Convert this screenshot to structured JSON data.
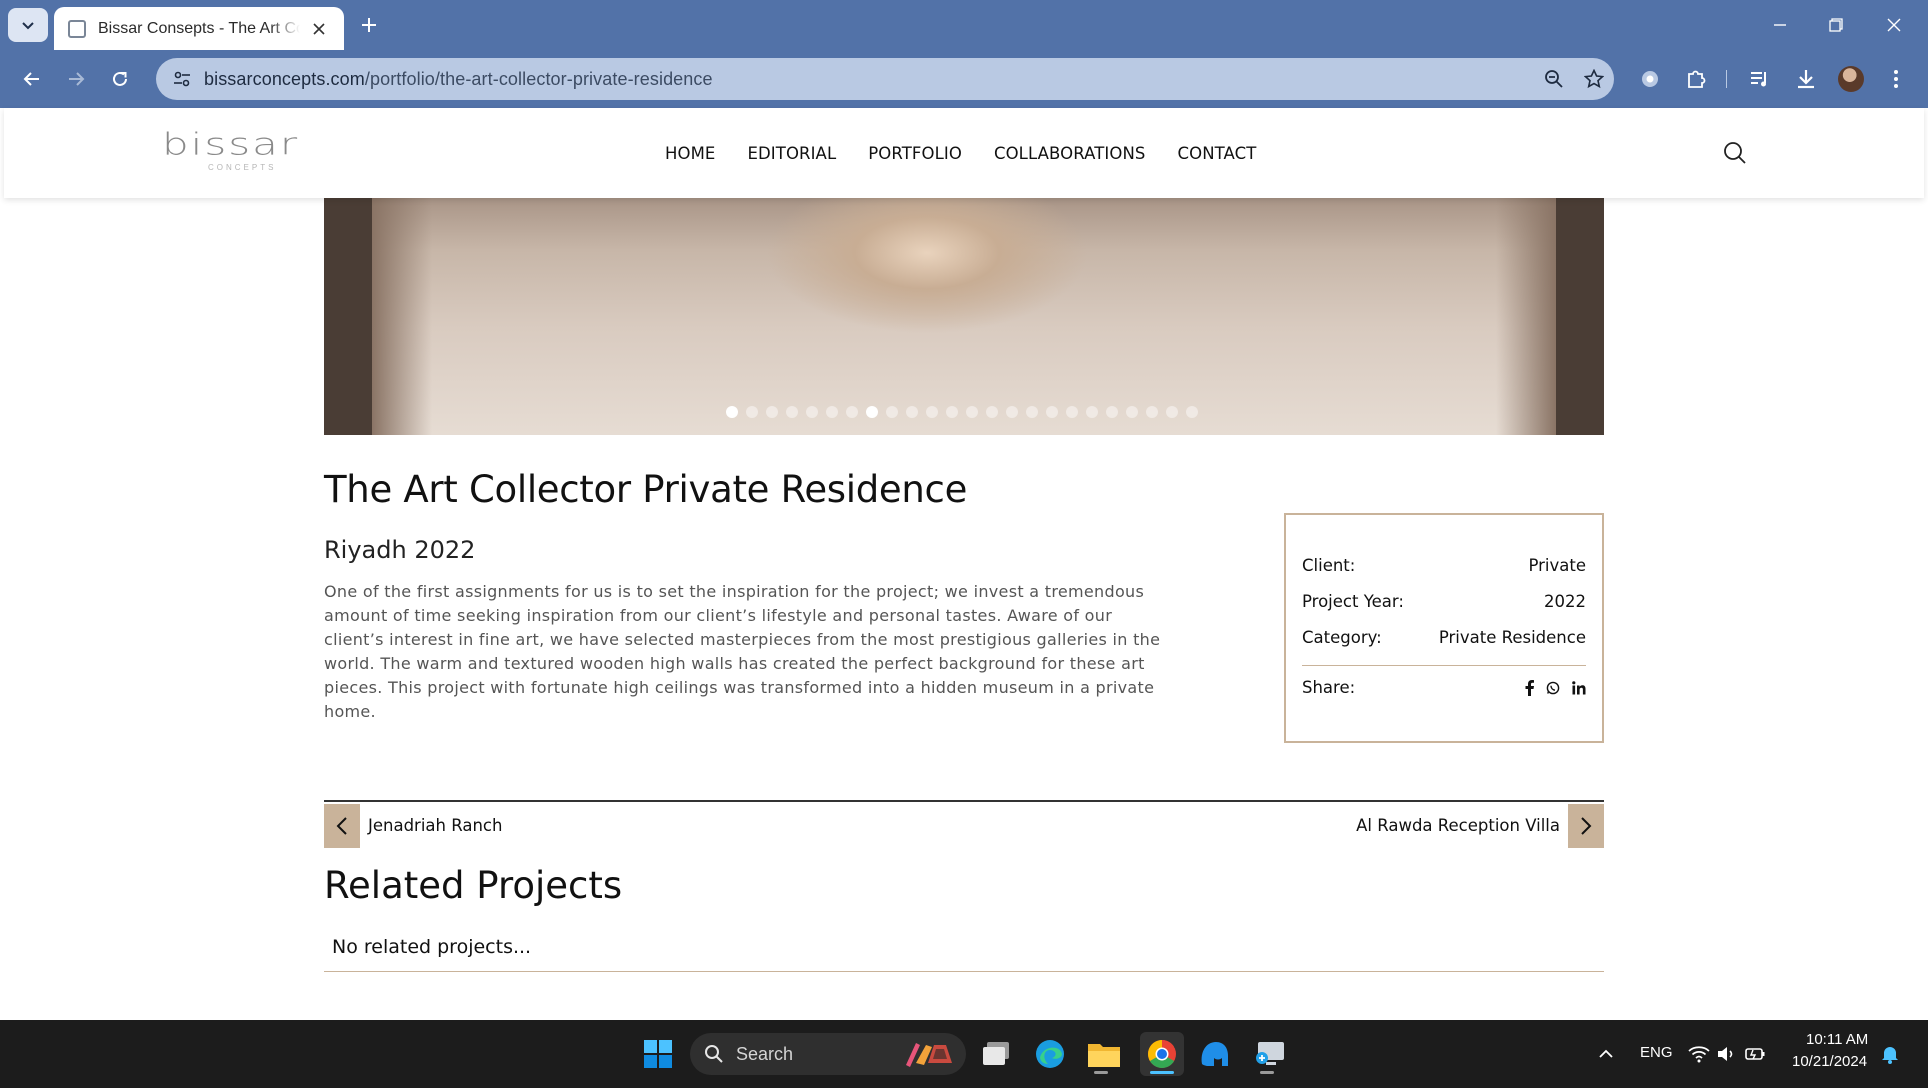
{
  "browser": {
    "tab_title": "Bissar Consepts - The Art Collector Private Residence",
    "url_host": "bissarconcepts.com",
    "url_path": "/portfolio/the-art-collector-private-residence"
  },
  "site": {
    "logo_text": "bissar",
    "logo_subtext": "CONCEPTS",
    "nav": [
      "HOME",
      "EDITORIAL",
      "PORTFOLIO",
      "COLLABORATIONS",
      "CONTACT"
    ]
  },
  "slider": {
    "slide_count": 24,
    "active_index": 7
  },
  "project": {
    "title": "The Art Collector Private Residence",
    "subtitle": "Riyadh 2022",
    "description": "One of the first assignments for us is to set the inspiration for the project; we invest a tremendous amount of time seeking inspiration from our client’s lifestyle and personal tastes. Aware of our client’s interest in fine art, we have selected masterpieces from the most prestigious galleries in the world. The warm and textured wooden high walls has created the perfect background for these art pieces. This project with fortunate high ceilings was transformed into a hidden museum in a private home."
  },
  "info": {
    "client_label": "Client:",
    "client_value": "Private",
    "year_label": "Project Year:",
    "year_value": "2022",
    "category_label": "Category:",
    "category_value": "Private Residence",
    "share_label": "Share:",
    "share_icons": [
      "facebook-icon",
      "whatsapp-icon",
      "linkedin-icon"
    ]
  },
  "pagination": {
    "prev_label": "Jenadriah Ranch",
    "next_label": "Al Rawda Reception Villa"
  },
  "related": {
    "title": "Related Projects",
    "empty_text": "No related projects..."
  },
  "taskbar": {
    "search_label": "Search",
    "language": "ENG",
    "time": "10:11 AM",
    "date": "10/21/2024"
  },
  "colors": {
    "chrome": "#5272a8",
    "accent": "#c9b39a",
    "taskbar": "#1c1c1c"
  }
}
